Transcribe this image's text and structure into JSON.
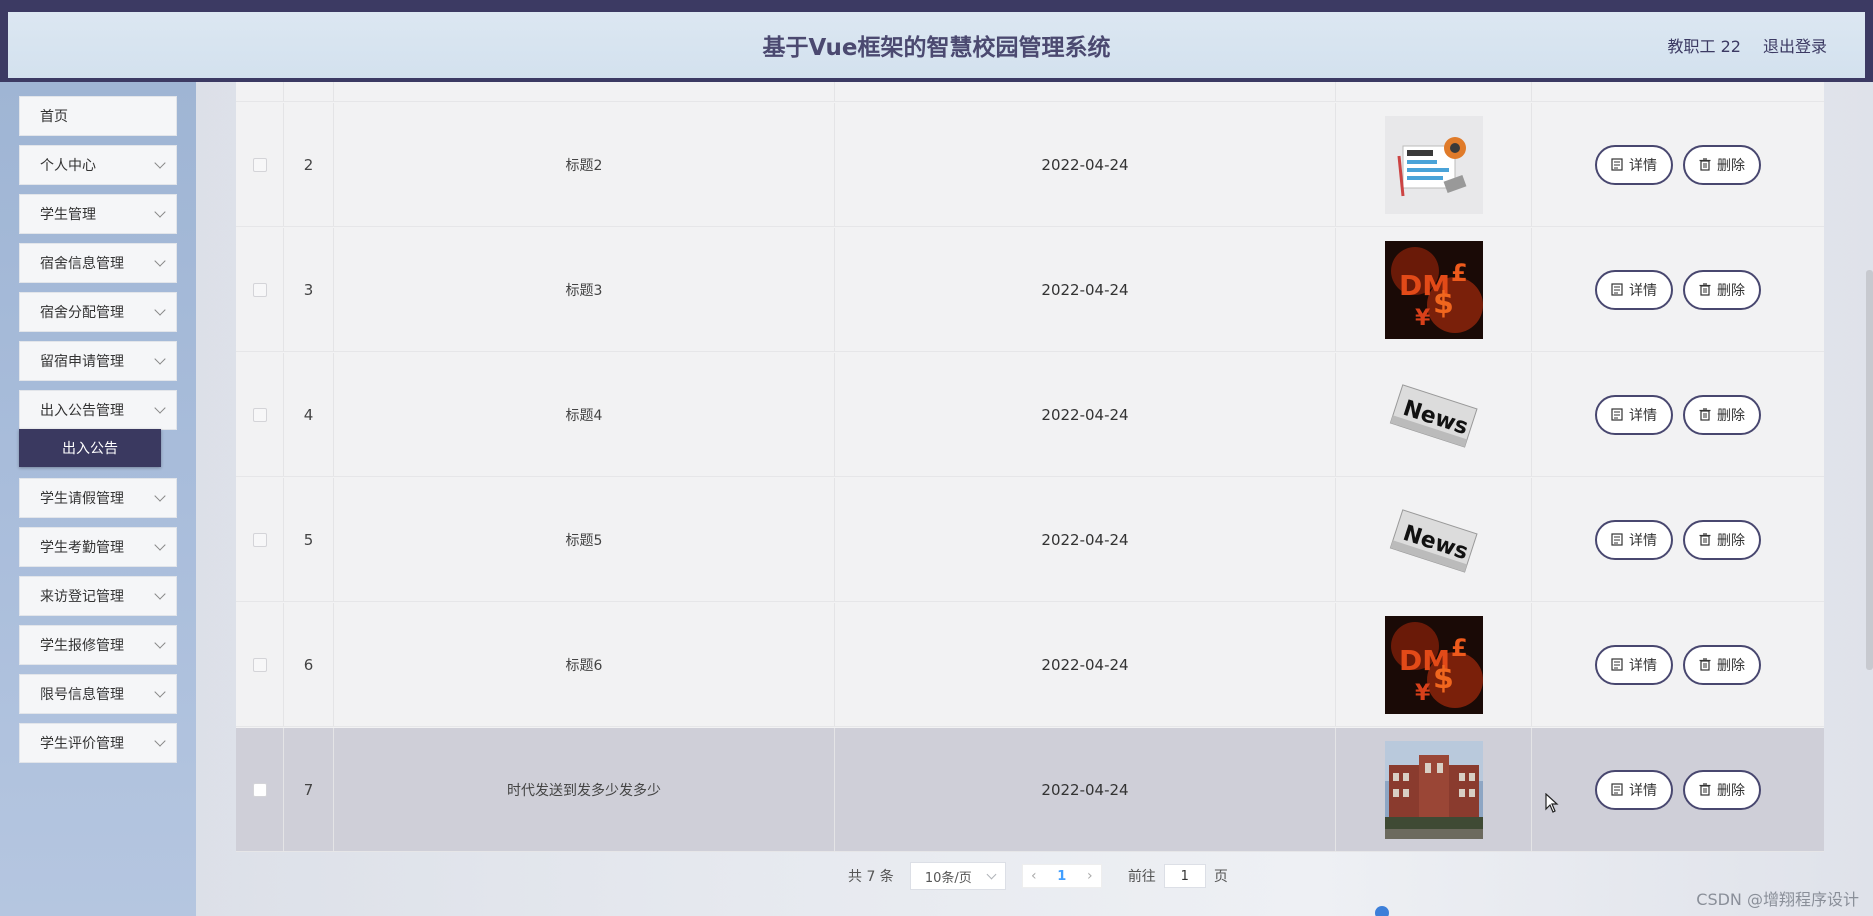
{
  "header": {
    "title": "基于Vue框架的智慧校园管理系统",
    "user_label": "教职工 22",
    "logout_label": "退出登录"
  },
  "sidebar": {
    "items": [
      {
        "label": "首页"
      },
      {
        "label": "个人中心"
      },
      {
        "label": "学生管理"
      },
      {
        "label": "宿舍信息管理"
      },
      {
        "label": "宿舍分配管理"
      },
      {
        "label": "留宿申请管理"
      },
      {
        "label": "出入公告管理"
      },
      {
        "label": "学生请假管理"
      },
      {
        "label": "学生考勤管理"
      },
      {
        "label": "来访登记管理"
      },
      {
        "label": "学生报修管理"
      },
      {
        "label": "限号信息管理"
      },
      {
        "label": "学生评价管理"
      }
    ],
    "active_submenu": "出入公告"
  },
  "table": {
    "detail_label": "详情",
    "delete_label": "删除",
    "rows": [
      {
        "index": "2",
        "title": "标题2",
        "date": "2022-04-24",
        "image": "news-clipart"
      },
      {
        "index": "3",
        "title": "标题3",
        "date": "2022-04-24",
        "image": "money-symbols"
      },
      {
        "index": "4",
        "title": "标题4",
        "date": "2022-04-24",
        "image": "news-paper"
      },
      {
        "index": "5",
        "title": "标题5",
        "date": "2022-04-24",
        "image": "news-paper"
      },
      {
        "index": "6",
        "title": "标题6",
        "date": "2022-04-24",
        "image": "money-symbols"
      },
      {
        "index": "7",
        "title": "时代发送到发多少发多少",
        "date": "2022-04-24",
        "image": "campus-building"
      }
    ]
  },
  "pagination": {
    "total": "共 7 条",
    "page_size": "10条/页",
    "current_page": "1",
    "goto_label": "前往",
    "goto_value": "1",
    "page_unit": "页"
  },
  "watermark": "CSDN @增翔程序设计"
}
